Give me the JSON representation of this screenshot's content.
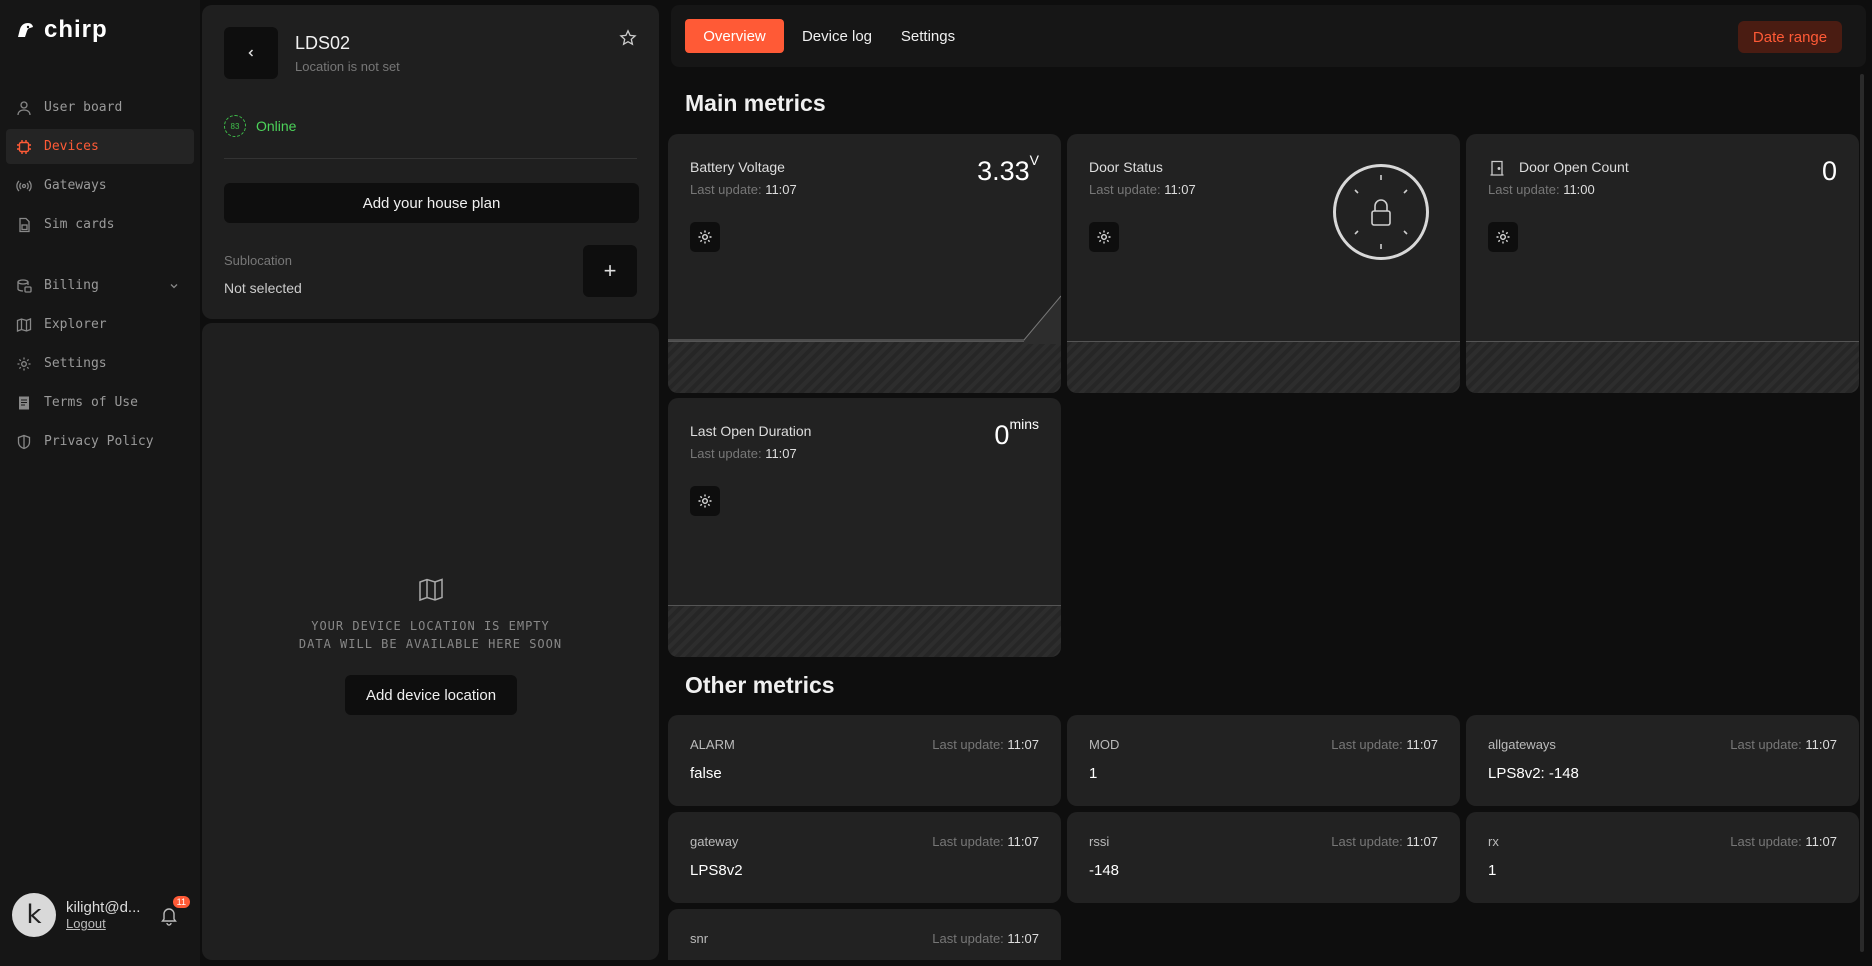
{
  "app": {
    "brand": "chirp"
  },
  "sidebar": {
    "items": [
      {
        "label": "User board",
        "icon": "user-icon"
      },
      {
        "label": "Devices",
        "icon": "chip-icon",
        "active": true
      },
      {
        "label": "Gateways",
        "icon": "antenna-icon"
      },
      {
        "label": "Sim cards",
        "icon": "sim-icon"
      },
      {
        "label": "Billing",
        "icon": "billing-icon",
        "expandable": true
      },
      {
        "label": "Explorer",
        "icon": "map-icon"
      },
      {
        "label": "Settings",
        "icon": "gear-icon"
      },
      {
        "label": "Terms of Use",
        "icon": "document-icon"
      },
      {
        "label": "Privacy Policy",
        "icon": "shield-icon"
      }
    ],
    "user": {
      "initial": "k",
      "name": "kilight@d...",
      "logout": "Logout",
      "notifications": "11"
    }
  },
  "device": {
    "name": "LDS02",
    "location": "Location is not set",
    "status_code": "83",
    "status": "Online",
    "add_plan": "Add your house plan",
    "sublocation_label": "Sublocation",
    "sublocation_value": "Not selected",
    "plus": "+",
    "empty_line1": "YOUR DEVICE LOCATION IS EMPTY",
    "empty_line2": "DATA WILL BE AVAILABLE HERE SOON",
    "add_location": "Add device location"
  },
  "tabs": [
    {
      "label": "Overview",
      "active": true
    },
    {
      "label": "Device log"
    },
    {
      "label": "Settings"
    }
  ],
  "date_range": "Date range",
  "main_metrics_title": "Main metrics",
  "other_metrics_title": "Other metrics",
  "last_update_label": "Last update:",
  "metrics": [
    {
      "name": "Battery Voltage",
      "time": "11:07",
      "value": "3.33",
      "unit": "V"
    },
    {
      "name": "Door Status",
      "time": "11:07",
      "value": "",
      "unit": "",
      "state": "locked"
    },
    {
      "name": "Door Open Count",
      "time": "11:00",
      "value": "0",
      "unit": ""
    },
    {
      "name": "Last Open Duration",
      "time": "11:07",
      "value": "0",
      "unit": "mins"
    }
  ],
  "other_metrics": [
    {
      "name": "ALARM",
      "time": "11:07",
      "value": "false"
    },
    {
      "name": "MOD",
      "time": "11:07",
      "value": "1"
    },
    {
      "name": "allgateways",
      "time": "11:07",
      "value": "LPS8v2: -148"
    },
    {
      "name": "gateway",
      "time": "11:07",
      "value": "LPS8v2"
    },
    {
      "name": "rssi",
      "time": "11:07",
      "value": "-148"
    },
    {
      "name": "rx",
      "time": "11:07",
      "value": "1"
    },
    {
      "name": "snr",
      "time": "11:07",
      "value": ""
    }
  ],
  "colors": {
    "accent": "#ff5a36",
    "online": "#4cd35a",
    "bg": "#0e0e0e",
    "card": "#222222"
  }
}
